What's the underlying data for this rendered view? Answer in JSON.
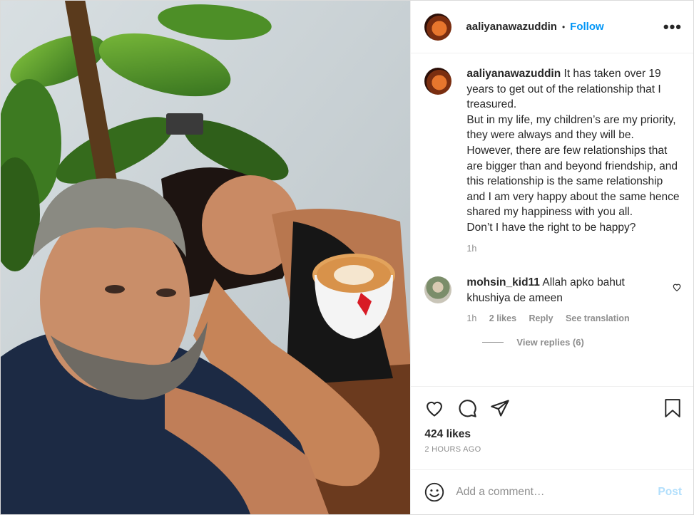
{
  "header": {
    "username": "aaliyanawazuddin",
    "separator": "•",
    "follow_label": "Follow",
    "more_label": "•••"
  },
  "caption": {
    "username": "aaliyanawazuddin",
    "text_lines": [
      "It has taken over 19 years to get out of the relationship that I treasured.",
      "But in my life, my children’s are my priority, they were always and they will be.",
      "However, there are few relationships that are bigger than and beyond friendship, and this relationship is the same relationship and I am very happy about the same hence shared my happiness with you all.",
      "Don’t I have the right to be happy?"
    ],
    "time": "1h"
  },
  "comment": {
    "username": "mohsin_kid11",
    "text": "Allah apko bahut khushiya de ameen",
    "time": "1h",
    "likes": "2 likes",
    "reply_label": "Reply",
    "translate_label": "See translation",
    "view_replies": "View replies (6)"
  },
  "actions": {
    "likes": "424 likes",
    "time_ago": "2 HOURS AGO"
  },
  "add_comment": {
    "placeholder": "Add a comment…",
    "post_label": "Post"
  },
  "icons": [
    "ellipsis-icon",
    "heart-icon",
    "comment-icon",
    "share-icon",
    "bookmark-icon",
    "emoji-icon",
    "heart-small-icon"
  ],
  "colors": {
    "accent": "#0095f6",
    "post_disabled": "#b2dffc",
    "muted": "#8e8e8e",
    "text": "#262626"
  }
}
